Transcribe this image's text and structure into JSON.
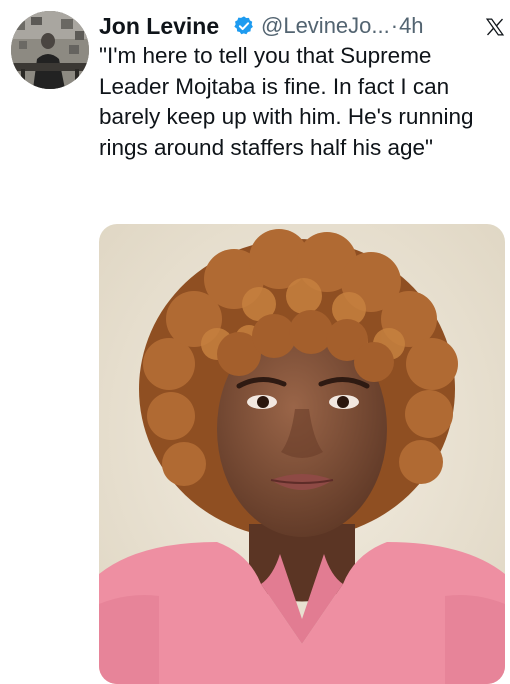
{
  "tweet": {
    "author_name": "Jon Levine",
    "handle": "@LevineJo...",
    "separator": "·",
    "time": "4h",
    "text": "\"I'm here to tell you that Supreme Leader Mojtaba is fine. In fact I can barely keep up with him. He's running rings around staffers half his age\"",
    "verified_icon": "verified-badge-icon",
    "platform_icon": "x-logo-icon"
  },
  "colors": {
    "verified_blue": "#1d9bf0",
    "secondary_text": "#536471",
    "photo_background": "#eae3d3",
    "photo_dress": "#ee8fa2",
    "photo_hair": "#a55e2a"
  }
}
